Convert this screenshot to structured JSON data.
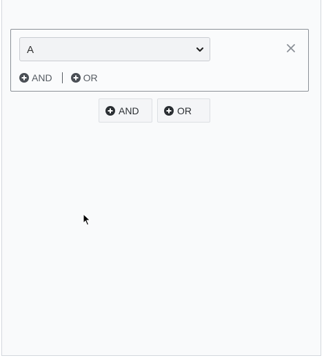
{
  "condition_group": {
    "select_value": "A",
    "inline_actions": {
      "and_label": "AND",
      "or_label": "OR"
    }
  },
  "actions": {
    "and_label": "AND",
    "or_label": "OR"
  },
  "icons": {
    "select": "chevron-down-icon",
    "remove": "close-icon",
    "add": "plus-circle-icon",
    "pointer": "mouse-cursor-icon"
  },
  "colors": {
    "panel_bg": "#f9fafb",
    "border": "#8a8f96",
    "text": "#333333",
    "icon": "#4a4f55"
  }
}
